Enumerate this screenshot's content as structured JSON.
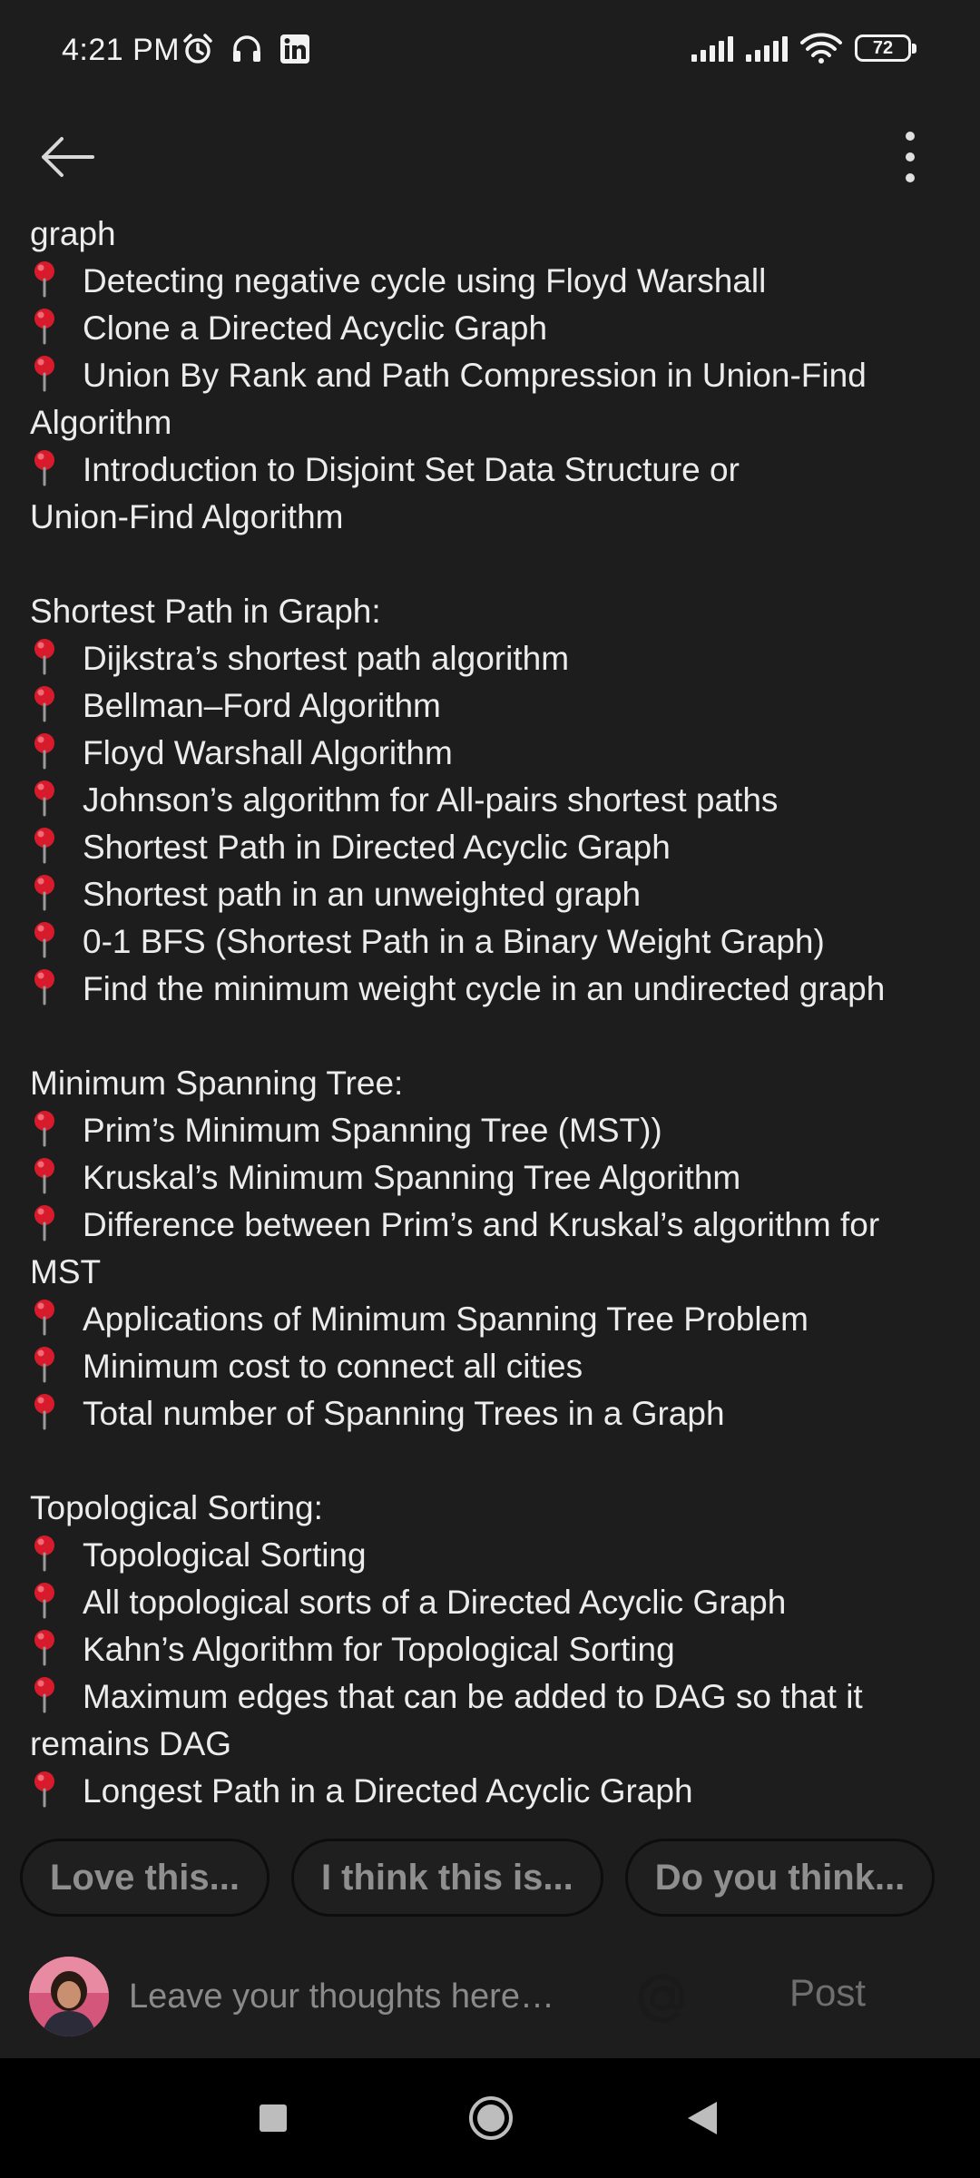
{
  "status_bar": {
    "time": "4:21 PM",
    "left_icons": [
      "alarm-icon",
      "headset-icon",
      "linkedin-icon"
    ],
    "battery": "72"
  },
  "app_bar": {
    "back_icon": "arrow-left-icon",
    "menu_icon": "more-vertical-icon"
  },
  "content": {
    "lines": [
      {
        "pin": false,
        "text": "graph"
      },
      {
        "pin": true,
        "text": "Detecting negative cycle using Floyd Warshall"
      },
      {
        "pin": true,
        "text": "Clone a Directed Acyclic Graph"
      },
      {
        "pin": true,
        "text": "Union By Rank and Path Compression in Union-Find"
      },
      {
        "pin": false,
        "text": "Algorithm"
      },
      {
        "pin": true,
        "text": "Introduction to Disjoint Set Data Structure or"
      },
      {
        "pin": false,
        "text": "Union-Find Algorithm"
      },
      {
        "pin": false,
        "text": ""
      },
      {
        "pin": false,
        "text": "Shortest Path in Graph:"
      },
      {
        "pin": true,
        "text": "Dijkstra’s shortest path algorithm"
      },
      {
        "pin": true,
        "text": "Bellman–Ford Algorithm"
      },
      {
        "pin": true,
        "text": "Floyd Warshall Algorithm"
      },
      {
        "pin": true,
        "text": "Johnson’s algorithm for All-pairs shortest paths"
      },
      {
        "pin": true,
        "text": "Shortest Path in Directed Acyclic Graph"
      },
      {
        "pin": true,
        "text": "Shortest path in an unweighted graph"
      },
      {
        "pin": true,
        "text": "0-1 BFS (Shortest Path in a Binary Weight Graph)"
      },
      {
        "pin": true,
        "text": "Find the minimum weight cycle in an undirected graph"
      },
      {
        "pin": false,
        "text": ""
      },
      {
        "pin": false,
        "text": "Minimum Spanning Tree:"
      },
      {
        "pin": true,
        "text": "Prim’s Minimum Spanning Tree (MST))"
      },
      {
        "pin": true,
        "text": "Kruskal’s Minimum Spanning Tree Algorithm"
      },
      {
        "pin": true,
        "text": "Difference between Prim’s and Kruskal’s algorithm for"
      },
      {
        "pin": false,
        "text": "MST"
      },
      {
        "pin": true,
        "text": "Applications of Minimum Spanning Tree Problem"
      },
      {
        "pin": true,
        "text": "Minimum cost to connect all cities"
      },
      {
        "pin": true,
        "text": "Total number of Spanning Trees in a Graph"
      },
      {
        "pin": false,
        "text": ""
      },
      {
        "pin": false,
        "text": "Topological Sorting:"
      },
      {
        "pin": true,
        "text": "Topological Sorting"
      },
      {
        "pin": true,
        "text": "All topological sorts of a Directed Acyclic Graph"
      },
      {
        "pin": true,
        "text": "Kahn’s Algorithm for Topological Sorting"
      },
      {
        "pin": true,
        "text": "Maximum edges that can be added to DAG so that it"
      },
      {
        "pin": false,
        "text": "remains DAG"
      },
      {
        "pin": true,
        "text": "Longest Path in a Directed Acyclic Graph"
      }
    ]
  },
  "quick_replies": [
    "Love this...",
    "I think this is...",
    "Do you think..."
  ],
  "comment": {
    "placeholder": "Leave your thoughts here…",
    "mention_label": "@",
    "post_label": "Post"
  },
  "colors": {
    "background": "#1d1d1d",
    "text": "#ececec",
    "pin_red": "#d81b2c",
    "muted": "#8f8f8f",
    "nav_bar": "#000000"
  }
}
